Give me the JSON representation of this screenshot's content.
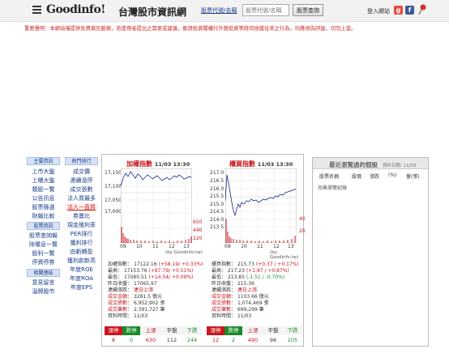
{
  "header": {
    "logo": "Goodinfo!",
    "logo_subtitle": "台灣股市資訊網",
    "search_label": "股票代號/名稱",
    "search_placeholder": "股票代號/名稱",
    "search_button": "股票查詢",
    "login": "登入網站"
  },
  "disclaimer": "重要聲明：本網站僅提供免費資訊服務，若使用者提出之需要或建議，衡請投資閣權行外匯投資等將同依據往來之行為，均應視為評論，切勿上當。",
  "nav": {
    "col1": {
      "header1": "主要資訊",
      "items1": [
        "上市大盤",
        "上櫃大盤",
        "類股一覽",
        "公告訊息",
        "股票篩選",
        "財報比較"
      ],
      "header2": "股票資訊",
      "items2": [
        "股票查詢報",
        "除權息一覽",
        "股利一覽",
        "停資停券"
      ],
      "header3": "相關連結",
      "items3": [
        "意見留言",
        "溫牌股市"
      ]
    },
    "col2": {
      "header": "熱門排行",
      "items": [
        "成交價",
        "連續漲停",
        "成交張數",
        "法人買最多",
        "法人一直買",
        "券賣比",
        "現金殖利率",
        "PER排行",
        "獲利排行",
        "由虧轉盈",
        "獲利創新高",
        "年度ROE",
        "年度ROA",
        "年度EPS"
      ],
      "highlighted": "法人一直買"
    }
  },
  "taiex": {
    "title": "加權指數",
    "time": "11/03 13:30",
    "y_labels": [
      "17,150",
      "17,100",
      "17,050",
      "17,000"
    ],
    "vol_labels": [
      "650",
      "440",
      "220"
    ],
    "x_labels": [
      "09",
      "10",
      "11",
      "12",
      "13"
    ],
    "source": "(by Goodinfo.tw)",
    "stats": [
      {
        "label": "加權指數：",
        "value": "17122.16",
        "change": "(+58.19/ +0.33%)",
        "tone": "red"
      },
      {
        "label": "最高：",
        "value": "17153.76",
        "change": "(+87.79/ +0.51%)",
        "tone": "red"
      },
      {
        "label": "最低：",
        "value": "17080.51",
        "change": "(+14.54/ +0.09%)",
        "tone": "red"
      },
      {
        "label": "昨日收盤：",
        "value": "17065.97",
        "change": "",
        "tone": "plain"
      },
      {
        "label": "連續漲跌：",
        "value": "連日上漲",
        "change": "",
        "tone": "red"
      },
      {
        "label": "成交金額：",
        "value": "3281.5 億元",
        "change": "",
        "tone": "red"
      },
      {
        "label": "成交張數：",
        "value": "6,952,902 張",
        "change": "",
        "tone": "red"
      },
      {
        "label": "成交筆數：",
        "value": "2,391,727 筆",
        "change": "",
        "tone": "red"
      },
      {
        "label": "資料時間：",
        "value": "11/03",
        "change": "",
        "tone": "plain"
      }
    ],
    "counts": {
      "headers": [
        "漲停",
        "跌停",
        "上漲",
        "平盤",
        "下跌"
      ],
      "values": [
        "8",
        "0",
        "630",
        "112",
        "244"
      ]
    }
  },
  "otc": {
    "title": "櫃買指數",
    "time": "11/03 13:30",
    "y_labels": [
      "217.0",
      "216.5",
      "216.0",
      "215.5",
      "215.0",
      "214.5",
      "214.0",
      "213.5"
    ],
    "vol_labels": [
      "40",
      "20"
    ],
    "x_labels": [
      "09",
      "10",
      "11",
      "12",
      "13"
    ],
    "source": "(by Goodinfo.tw)",
    "stats": [
      {
        "label": "櫃買指數：",
        "value": "215.73",
        "change": "(+0.37 / +0.17%)",
        "tone": "red"
      },
      {
        "label": "最高：",
        "value": "217.23",
        "change": "(+1.87 / +0.87%)",
        "tone": "red"
      },
      {
        "label": "最低：",
        "value": "213.85",
        "change": "(-1.51 / -0.70%)",
        "tone": "green"
      },
      {
        "label": "昨日收盤：",
        "value": "215.36",
        "change": "",
        "tone": "plain"
      },
      {
        "label": "連續漲跌：",
        "value": "連日上漲",
        "change": "",
        "tone": "red"
      },
      {
        "label": "成交金額：",
        "value": "1103.66 億元",
        "change": "",
        "tone": "red"
      },
      {
        "label": "成交張數：",
        "value": "1,074,469 張",
        "change": "",
        "tone": "red"
      },
      {
        "label": "成交筆數：",
        "value": "699,299 筆",
        "change": "",
        "tone": "red"
      },
      {
        "label": "資料時間：",
        "value": "11/03",
        "change": "",
        "tone": "plain"
      }
    ],
    "counts": {
      "headers": [
        "漲停",
        "跌停",
        "上漲",
        "平盤",
        "下跌"
      ],
      "values": [
        "12",
        "2",
        "490",
        "96",
        "205"
      ]
    }
  },
  "recent": {
    "title": "最近瀏覽過的個股",
    "time": "資料日期: 11/03",
    "columns": [
      "股票名稱",
      "股價",
      "漲跌",
      "(%)",
      "量(張)"
    ],
    "empty": "尚無瀏覽紀錄"
  },
  "colors": {
    "up": "#c8171d",
    "down": "#1b8a2b",
    "line": "#1a2a8a",
    "nav_link": "#1a3e8a"
  },
  "icons": [
    "menu-icon",
    "google-icon",
    "facebook-icon",
    "pin-icon"
  ]
}
